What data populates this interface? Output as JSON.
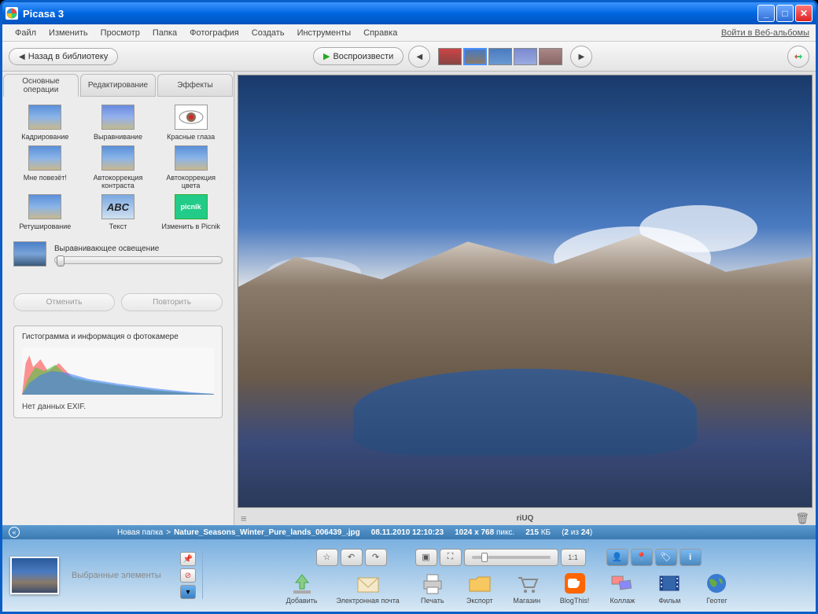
{
  "titlebar": {
    "title": "Picasa 3"
  },
  "menubar": {
    "items": [
      "Файл",
      "Изменить",
      "Просмотр",
      "Папка",
      "Фотография",
      "Создать",
      "Инструменты",
      "Справка"
    ],
    "login": "Войти в Веб-альбомы"
  },
  "topbar": {
    "back": "Назад в библиотеку",
    "play": "Воспроизвести"
  },
  "tabs": {
    "basic": "Основные операции",
    "edit": "Редактирование",
    "effects": "Эффекты"
  },
  "ops": {
    "crop": "Кадрирование",
    "straighten": "Выравнивание",
    "redeye": "Красные глаза",
    "lucky": "Мне повезёт!",
    "contrast": "Автокоррекция контраста",
    "color": "Автокоррекция цвета",
    "retouch": "Ретуширование",
    "text": "Текст",
    "picnik": "Изменить в Picnik",
    "picnik_logo": "picnik"
  },
  "fill_light": {
    "label": "Выравнивающее освещение"
  },
  "undo": {
    "undo": "Отменить",
    "redo": "Повторить"
  },
  "histogram": {
    "title": "Гистограмма и информация о фотокамере",
    "exif": "Нет данных EXIF."
  },
  "caption": {
    "text": "riUQ"
  },
  "status": {
    "folder": "Новая папка",
    "sep": ">",
    "file": "Nature_Seasons_Winter_Pure_lands_006439_.jpg",
    "date": "08.11.2010 12:10:23",
    "dims": "1024 x 768",
    "dims_suffix": "пикс.",
    "size": "215",
    "size_suffix": "КБ",
    "count": "(2 из 24)"
  },
  "bottombar": {
    "selected": "Выбранные элементы",
    "actions": {
      "add": "Добавить",
      "email": "Электронная почта",
      "print": "Печать",
      "export": "Экспорт",
      "shop": "Магазин",
      "blog": "BlogThis!",
      "collage": "Коллаж",
      "movie": "Фильм",
      "geotag": "Геотег"
    },
    "onetoone": "1:1"
  }
}
